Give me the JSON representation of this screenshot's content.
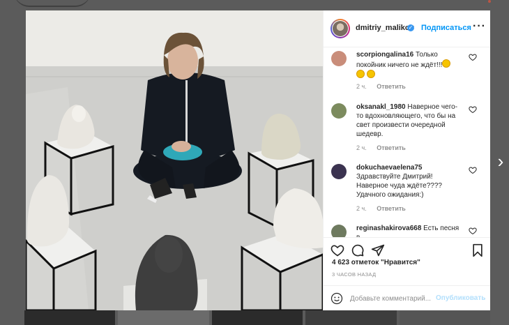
{
  "post": {
    "username": "dmitriy_malikov",
    "follow_label": "Подписаться",
    "more_icon": "more-dots-icon",
    "likes": "4 623 отметок \"Нравится\"",
    "time_ago": "3 ЧАСОВ НАЗАД"
  },
  "comments": [
    {
      "user": "scorpiongalina16",
      "text": "Только покойник ничего не ждёт!!!",
      "time": "2 ч.",
      "reply": "Ответить",
      "avatar_color": "#c98d7a"
    },
    {
      "user": "oksanakl_1980",
      "text": "Наверное чего-то вдохновляющего, что бы на свет произвести очередной шедевр.",
      "time": "2 ч.",
      "reply": "Ответить",
      "avatar_color": "#7c8b5e"
    },
    {
      "user": "dokuchaevaelena75",
      "text": "Здравствуйте Дмитрий! Наверное чуда ждёте???? Удачного ожидания:)",
      "time": "2 ч.",
      "reply": "Ответить",
      "avatar_color": "#3b3350"
    },
    {
      "user": "reginashakirova668",
      "text": "Есть песня в",
      "time": "",
      "reply": "",
      "avatar_color": "#6e7a5f"
    }
  ],
  "add_comment": {
    "placeholder": "Добавьте комментарий...",
    "publish_label": "Опубликовать"
  },
  "colors": {
    "link": "#0095f6",
    "publish_disabled": "#b2dffc",
    "verified": "#3897f0"
  }
}
